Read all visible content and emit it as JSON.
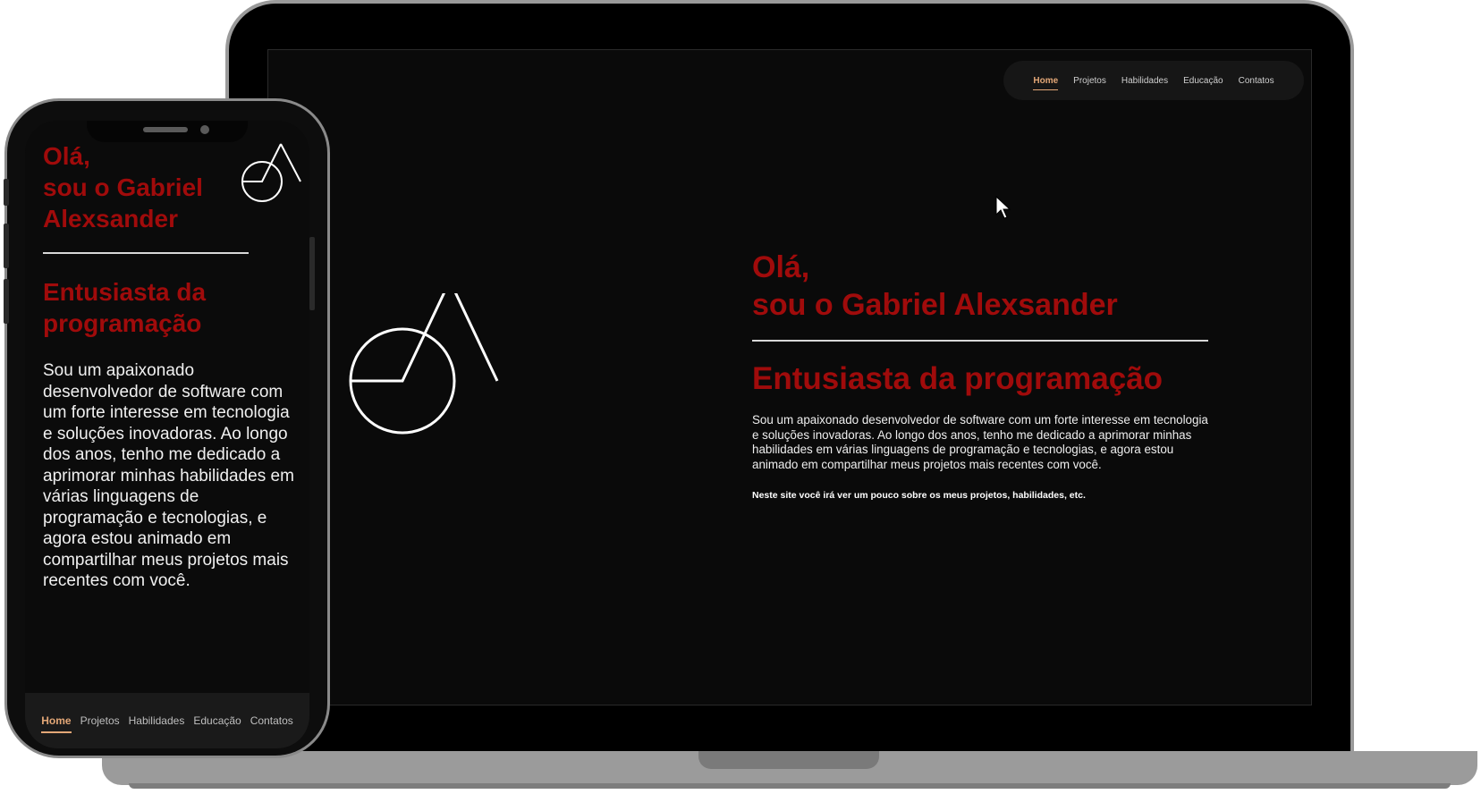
{
  "nav": {
    "items": [
      {
        "label": "Home",
        "active": true
      },
      {
        "label": "Projetos",
        "active": false
      },
      {
        "label": "Habilidades",
        "active": false
      },
      {
        "label": "Educação",
        "active": false
      },
      {
        "label": "Contatos",
        "active": false
      }
    ]
  },
  "hero": {
    "greeting": "Olá,",
    "name_line": "sou o Gabriel Alexsander",
    "name_line_mobile_1": "sou o Gabriel",
    "name_line_mobile_2": "Alexsander",
    "subtitle": "Entusiasta da programação",
    "subtitle_mobile_1": "Entusiasta da",
    "subtitle_mobile_2": "programação",
    "description": "Sou um apaixonado desenvolvedor de software com um forte interesse em tecnologia e soluções inovadoras. Ao longo dos anos, tenho me dedicado a aprimorar minhas habilidades em várias linguagens de programação e tecnologias, e agora estou animado em compartilhar meus projetos mais recentes com você.",
    "note": "Neste site você irá ver um pouco sobre os meus projetos, habilidades, etc."
  },
  "colors": {
    "accent_red": "#a00b0b",
    "nav_active": "#e3a777",
    "background": "#0a0a0a"
  },
  "icons": {
    "logo": "ga-monogram-logo-icon",
    "cursor": "mouse-pointer-icon"
  }
}
